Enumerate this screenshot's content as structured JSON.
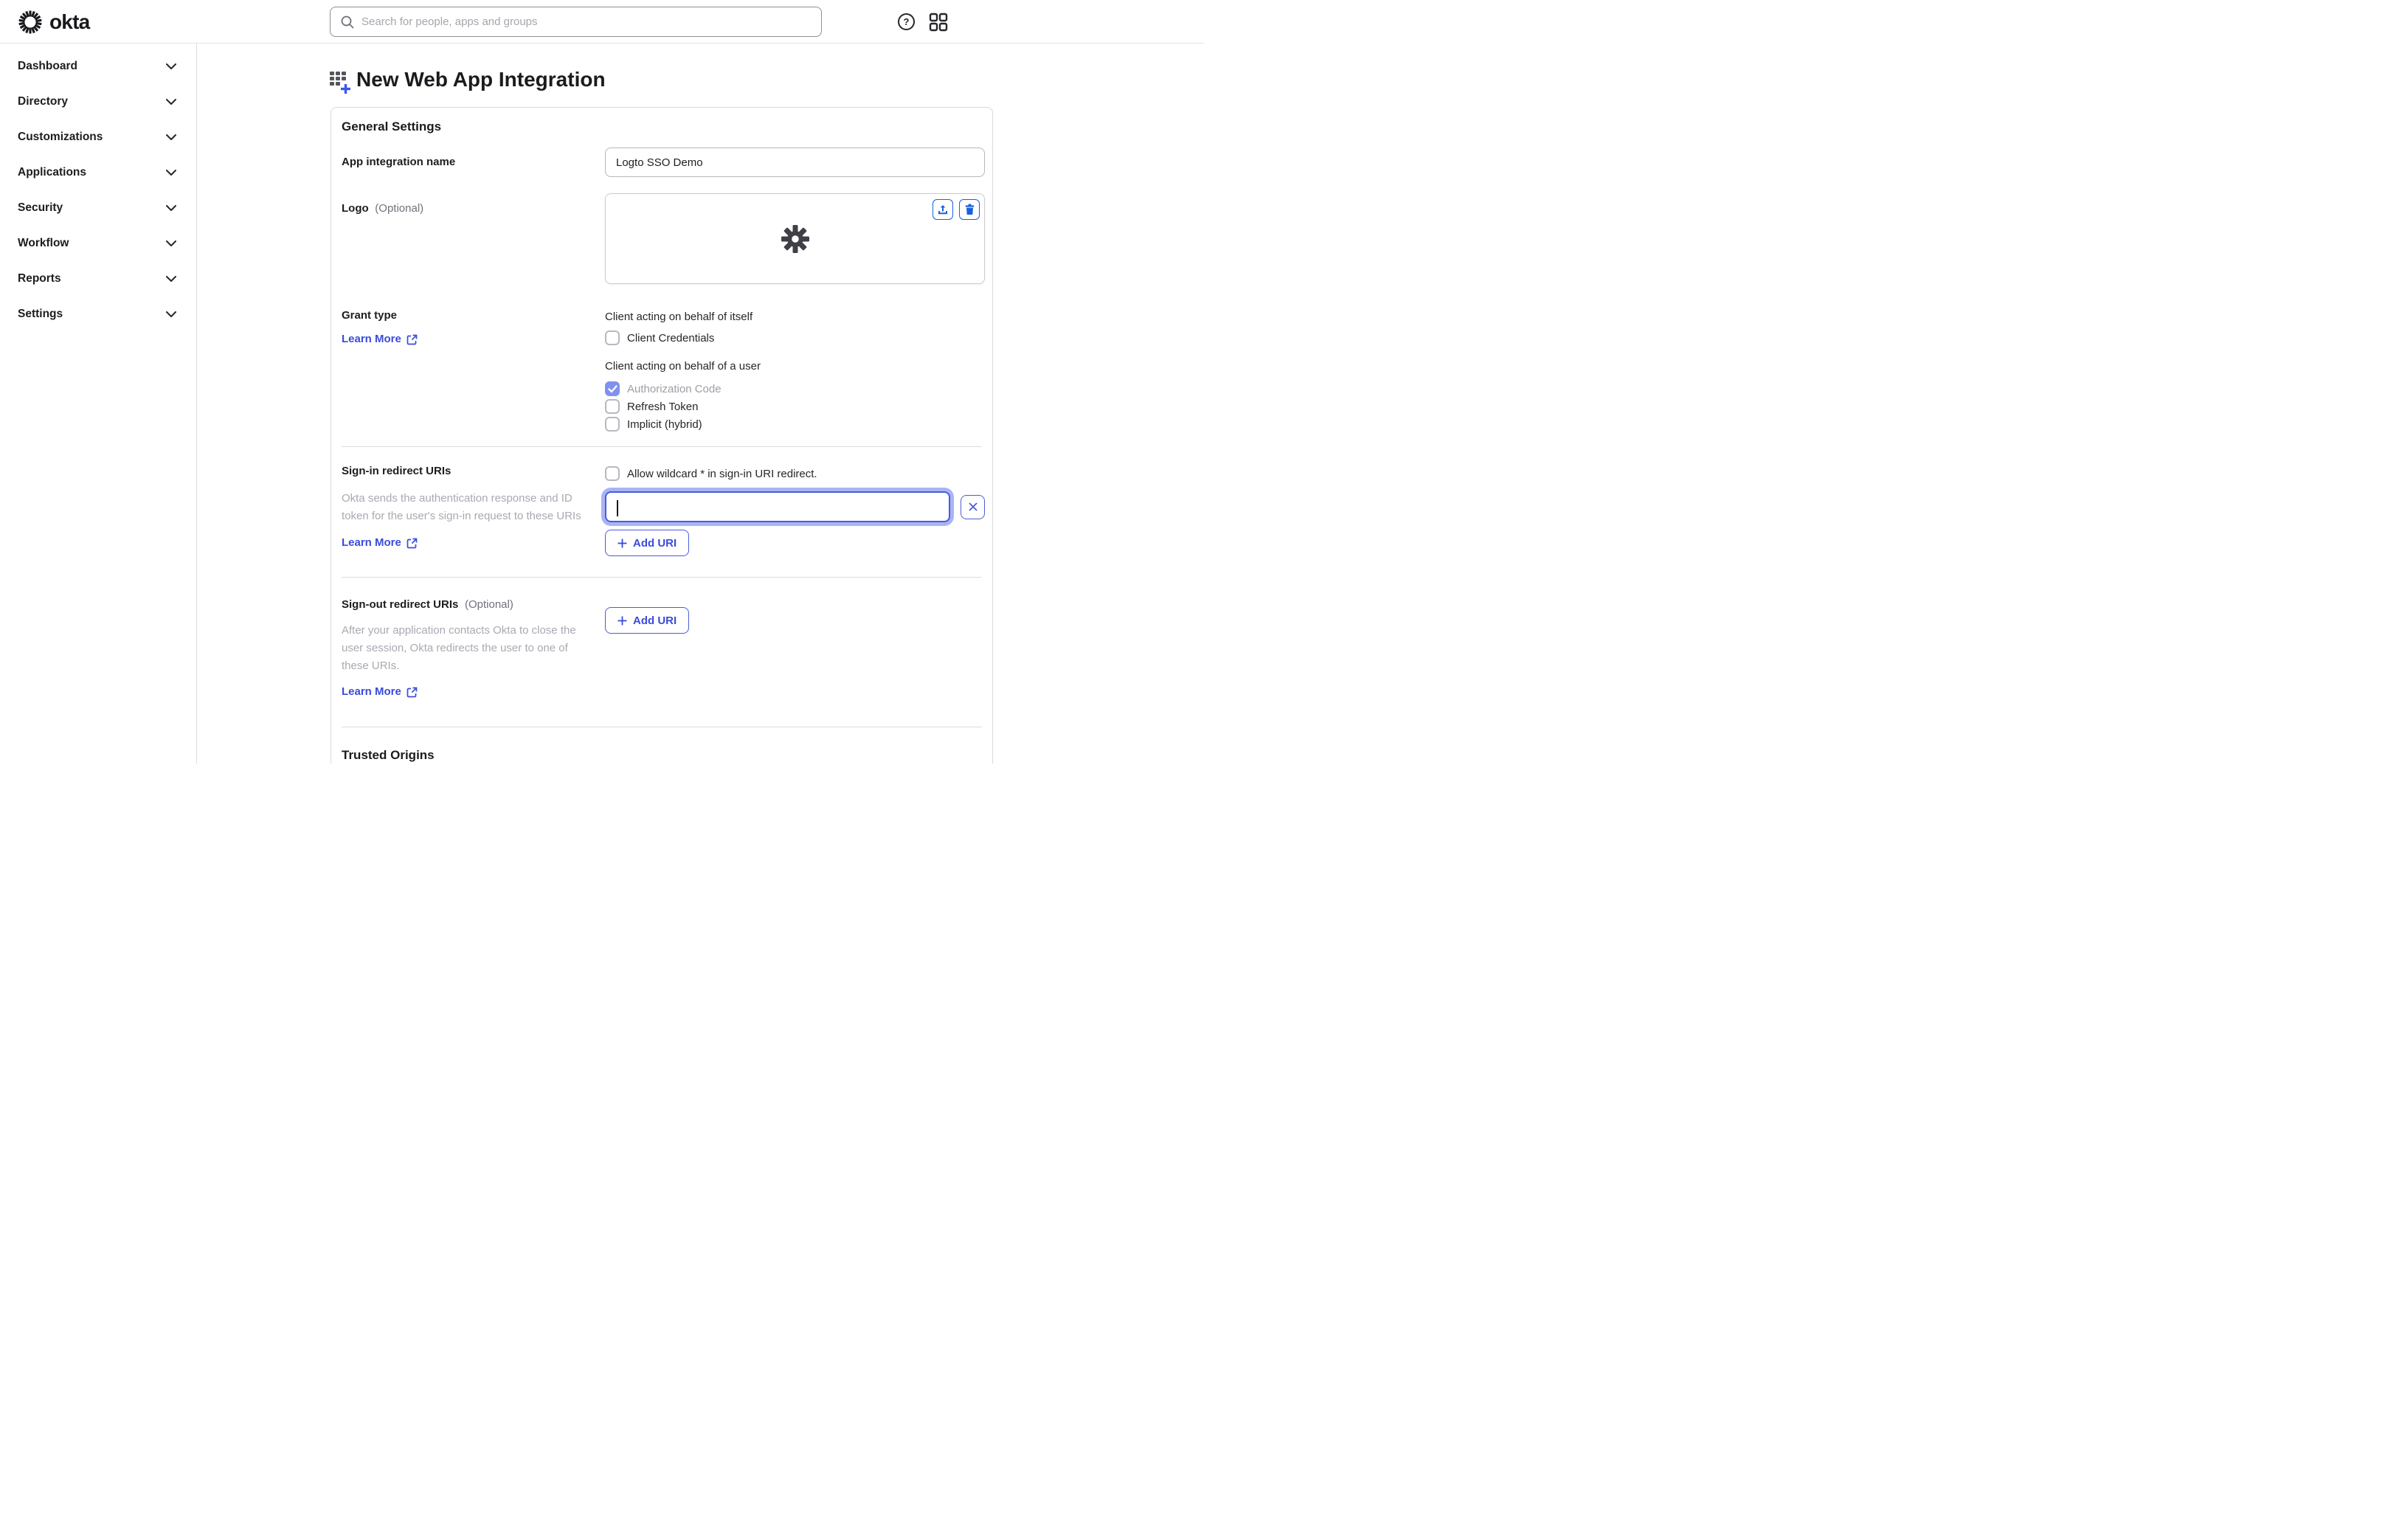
{
  "header": {
    "brand": "okta",
    "search_placeholder": "Search for people, apps and groups"
  },
  "sidebar": {
    "items": [
      {
        "label": "Dashboard"
      },
      {
        "label": "Directory"
      },
      {
        "label": "Customizations"
      },
      {
        "label": "Applications"
      },
      {
        "label": "Security"
      },
      {
        "label": "Workflow"
      },
      {
        "label": "Reports"
      },
      {
        "label": "Settings"
      }
    ]
  },
  "page": {
    "title": "New Web App Integration"
  },
  "general": {
    "heading": "General Settings",
    "app_name": {
      "label": "App integration name",
      "value": "Logto SSO Demo"
    },
    "logo": {
      "label": "Logo",
      "optional": "(Optional)"
    },
    "grant_type": {
      "label": "Grant type",
      "learn_more": "Learn More",
      "group1_title": "Client acting on behalf of itself",
      "group1_options": [
        {
          "label": "Client Credentials",
          "checked": false
        }
      ],
      "group2_title": "Client acting on behalf of a user",
      "group2_options": [
        {
          "label": "Authorization Code",
          "checked": true
        },
        {
          "label": "Refresh Token",
          "checked": false
        },
        {
          "label": "Implicit (hybrid)",
          "checked": false
        }
      ]
    },
    "signin": {
      "label": "Sign-in redirect URIs",
      "wildcard_label": "Allow wildcard * in sign-in URI redirect.",
      "helper": "Okta sends the authentication response and ID token for the user's sign-in request to these URIs",
      "learn_more": "Learn More",
      "input_value": "",
      "add_button": "Add URI"
    },
    "signout": {
      "label": "Sign-out redirect URIs",
      "optional": "(Optional)",
      "helper": "After your application contacts Okta to close the user session, Okta redirects the user to one of these URIs.",
      "learn_more": "Learn More",
      "add_button": "Add URI"
    },
    "trusted_origins_heading": "Trusted Origins"
  },
  "colors": {
    "link_indigo": "#3a4bdc",
    "button_border": "#4a5cd8",
    "checkbox_checked": "#8091ef",
    "focus_halo": "#a9b4f5",
    "action_icon_blue": "#1662dd",
    "text_dark": "#1e1e22",
    "helper_gray": "#a9a9b2"
  }
}
